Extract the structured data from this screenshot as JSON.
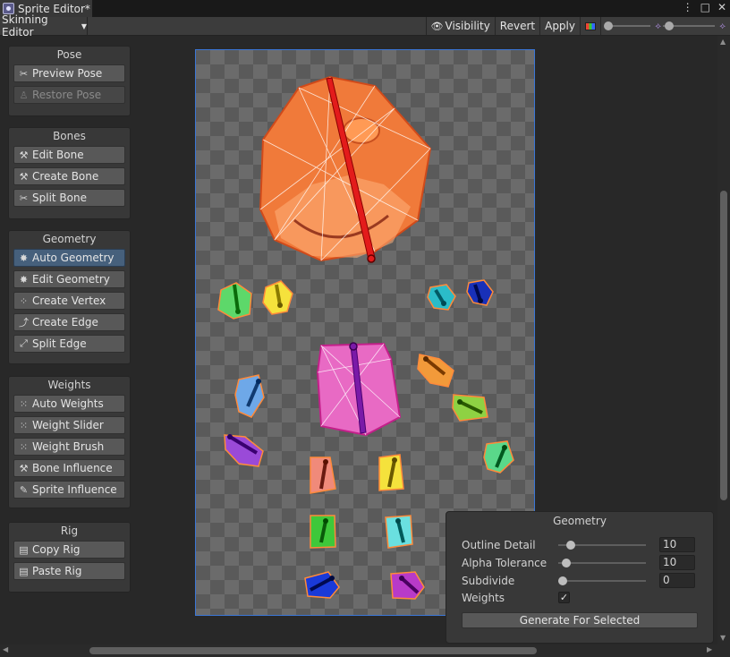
{
  "window": {
    "tab_title": "Sprite Editor*",
    "window_buttons": [
      "⋮",
      "□",
      "✕"
    ]
  },
  "toolbar": {
    "mode_dropdown": "Skinning Editor",
    "visibility": "Visibility",
    "revert": "Revert",
    "apply": "Apply"
  },
  "panels": {
    "pose": {
      "title": "Pose",
      "buttons": [
        {
          "label": "Preview Pose",
          "icon": "pose-icon"
        },
        {
          "label": "Restore Pose",
          "icon": "restore-pose-icon",
          "disabled": true
        }
      ]
    },
    "bones": {
      "title": "Bones",
      "buttons": [
        {
          "label": "Edit Bone",
          "icon": "edit-bone-icon"
        },
        {
          "label": "Create Bone",
          "icon": "create-bone-icon"
        },
        {
          "label": "Split Bone",
          "icon": "split-bone-icon"
        }
      ]
    },
    "geometry": {
      "title": "Geometry",
      "buttons": [
        {
          "label": "Auto Geometry",
          "icon": "auto-geometry-icon",
          "active": true
        },
        {
          "label": "Edit Geometry",
          "icon": "edit-geometry-icon"
        },
        {
          "label": "Create Vertex",
          "icon": "create-vertex-icon"
        },
        {
          "label": "Create Edge",
          "icon": "create-edge-icon"
        },
        {
          "label": "Split Edge",
          "icon": "split-edge-icon"
        }
      ]
    },
    "weights": {
      "title": "Weights",
      "buttons": [
        {
          "label": "Auto Weights",
          "icon": "auto-weights-icon"
        },
        {
          "label": "Weight Slider",
          "icon": "weight-slider-icon"
        },
        {
          "label": "Weight Brush",
          "icon": "weight-brush-icon"
        },
        {
          "label": "Bone Influence",
          "icon": "bone-influence-icon"
        },
        {
          "label": "Sprite Influence",
          "icon": "sprite-influence-icon"
        }
      ]
    },
    "rig": {
      "title": "Rig",
      "buttons": [
        {
          "label": "Copy Rig",
          "icon": "copy-rig-icon"
        },
        {
          "label": "Paste Rig",
          "icon": "paste-rig-icon"
        }
      ]
    }
  },
  "geometry_popup": {
    "title": "Geometry",
    "outline_detail": {
      "label": "Outline Detail",
      "value": "10",
      "fraction": 0.1
    },
    "alpha_tolerance": {
      "label": "Alpha Tolerance",
      "value": "10",
      "fraction": 0.04
    },
    "subdivide": {
      "label": "Subdivide",
      "value": "0",
      "fraction": 0.0
    },
    "weights": {
      "label": "Weights",
      "checked": true,
      "check_glyph": "✓"
    },
    "generate_button": "Generate For Selected"
  }
}
